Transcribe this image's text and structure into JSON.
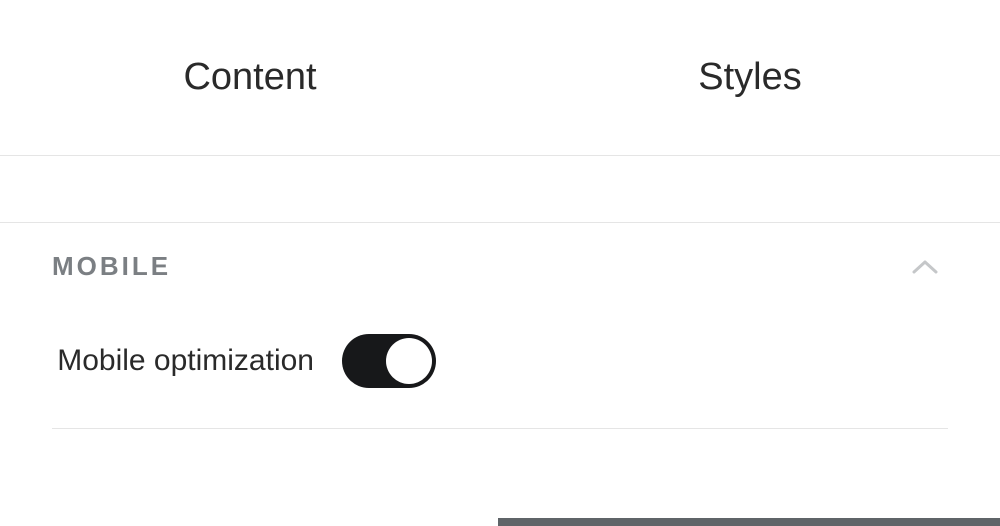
{
  "tabs": {
    "content": {
      "label": "Content",
      "active": false
    },
    "styles": {
      "label": "Styles",
      "active": true
    }
  },
  "section": {
    "title": "MOBILE",
    "expanded": true
  },
  "settings": {
    "mobile_optimization": {
      "label": "Mobile optimization",
      "enabled": true
    }
  }
}
